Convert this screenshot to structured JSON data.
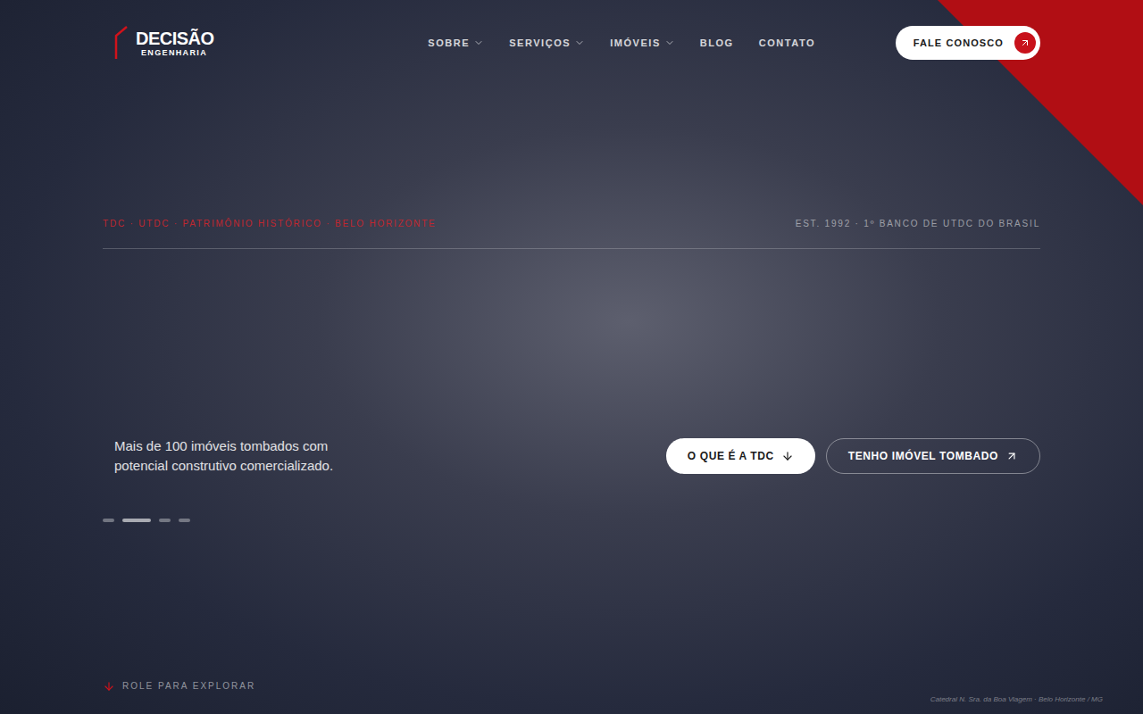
{
  "logo": {
    "name": "DECISÃO",
    "subtitle": "ENGENHARIA"
  },
  "nav": [
    {
      "label": "SOBRE",
      "dropdown": true
    },
    {
      "label": "SERVIÇOS",
      "dropdown": true
    },
    {
      "label": "IMÓVEIS",
      "dropdown": true
    },
    {
      "label": "BLOG",
      "dropdown": false
    },
    {
      "label": "CONTATO",
      "dropdown": false
    }
  ],
  "cta": {
    "label": "FALE CONOSCO"
  },
  "eyebrow": {
    "left": "TDC · UTDC · PATRIMÔNIO HISTÓRICO · BELO HORIZONTE",
    "right": "EST. 1992 · 1º BANCO DE UTDC DO BRASIL"
  },
  "hero": {
    "tagline": "Mais de 100 imóveis tombados com potencial construtivo comercializado.",
    "buttons": [
      {
        "label": "O QUE É A TDC",
        "kind": "primary"
      },
      {
        "label": "TENHO IMÓVEL TOMBADO",
        "kind": "outline"
      }
    ]
  },
  "slides": [
    {
      "selected": false
    },
    {
      "selected": true
    },
    {
      "selected": false
    },
    {
      "selected": false
    }
  ],
  "scroll_hint": "ROLE PARA EXPLORAR",
  "caption": "Catedral N. Sra. da Boa Viagem · Belo Horizonte / MG"
}
